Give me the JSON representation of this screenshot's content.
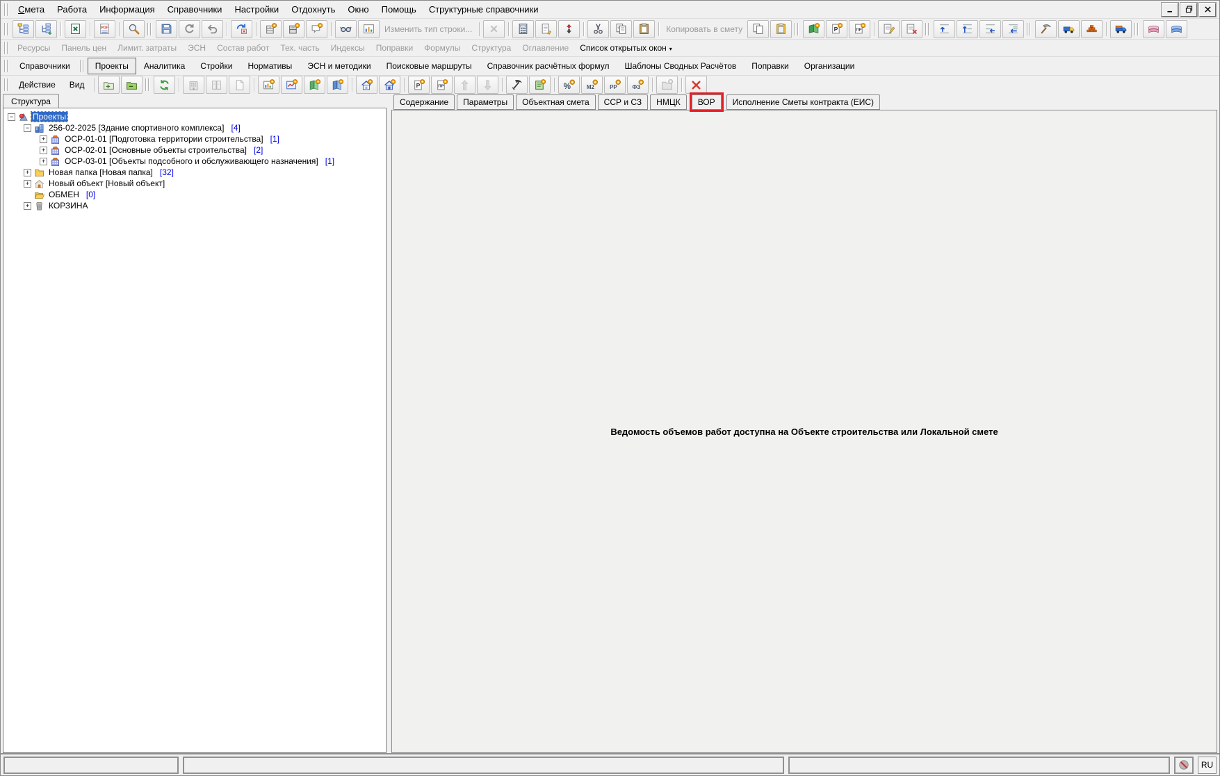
{
  "colors": {
    "selection_blue": "#316ac5",
    "count_blue": "#0000e6",
    "highlight_red": "#e41e26"
  },
  "menubar": {
    "items": [
      {
        "id": "smeta",
        "label": "Смета",
        "accel": true
      },
      {
        "id": "rabota",
        "label": "Работа"
      },
      {
        "id": "informaciya",
        "label": "Информация"
      },
      {
        "id": "spravochniki",
        "label": "Справочники"
      },
      {
        "id": "nastroyki",
        "label": "Настройки"
      },
      {
        "id": "otdohnut",
        "label": "Отдохнуть"
      },
      {
        "id": "okno",
        "label": "Окно"
      },
      {
        "id": "pomosch",
        "label": "Помощь"
      },
      {
        "id": "strukturnye-spravochniki",
        "label": "Структурные справочники"
      }
    ]
  },
  "window_controls": [
    "minimize",
    "restore",
    "close"
  ],
  "toolbar_main": {
    "groups": [
      {
        "grip": true,
        "buttons": [
          {
            "icon": "tree-structure"
          },
          {
            "icon": "tree-add"
          }
        ]
      },
      {
        "buttons": [
          {
            "icon": "excel"
          }
        ]
      },
      {
        "buttons": [
          {
            "icon": "pdf"
          }
        ]
      },
      {
        "buttons": [
          {
            "icon": "search"
          }
        ]
      },
      {
        "grip": true,
        "buttons": [
          {
            "icon": "save"
          },
          {
            "icon": "refresh"
          },
          {
            "icon": "undo"
          }
        ]
      },
      {
        "buttons": [
          {
            "icon": "unlock"
          }
        ]
      },
      {
        "buttons": [
          {
            "icon": "cabinet-gear"
          },
          {
            "icon": "cabinet-gear2"
          },
          {
            "icon": "comment-gear"
          }
        ]
      },
      {
        "buttons": [
          {
            "icon": "glasses"
          },
          {
            "icon": "chart"
          },
          {
            "label": "Изменить тип строки...",
            "disabled": true,
            "name": "change-row-type-button"
          }
        ]
      },
      {
        "buttons": [
          {
            "icon": "close-gray",
            "disabled": true
          }
        ]
      },
      {
        "buttons": [
          {
            "icon": "calculator"
          },
          {
            "icon": "page-edit"
          },
          {
            "icon": "sort-updown"
          }
        ]
      },
      {
        "buttons": [
          {
            "icon": "cut"
          },
          {
            "icon": "copy"
          },
          {
            "icon": "paste"
          }
        ]
      },
      {
        "buttons": [
          {
            "label": "Копировать в смету",
            "disabled": true,
            "name": "copy-to-estimate-button"
          },
          {
            "icon": "copy-doc"
          },
          {
            "icon": "paste-doc"
          }
        ]
      },
      {
        "grip": true,
        "buttons": [
          {
            "icon": "book-gear"
          },
          {
            "icon": "page-p"
          },
          {
            "icon": "page-pr"
          }
        ]
      },
      {
        "buttons": [
          {
            "icon": "edit-add"
          },
          {
            "icon": "edit-del"
          }
        ]
      },
      {
        "grip": true,
        "buttons": [
          {
            "icon": "indent-up"
          },
          {
            "icon": "indent-up2"
          },
          {
            "icon": "indent-left"
          },
          {
            "icon": "indent-left2"
          }
        ]
      },
      {
        "grip": true,
        "buttons": [
          {
            "icon": "hammer"
          },
          {
            "icon": "truck"
          },
          {
            "icon": "bricks"
          }
        ]
      },
      {
        "buttons": [
          {
            "icon": "truck-cargo"
          }
        ]
      },
      {
        "grip": true,
        "buttons": [
          {
            "icon": "book-pink"
          },
          {
            "icon": "book-blue"
          }
        ]
      }
    ]
  },
  "panel_strip": {
    "dropdown_glyph": "▾",
    "items": [
      {
        "id": "resursy",
        "label": "Ресурсы",
        "disabled": true
      },
      {
        "id": "panel-cen",
        "label": "Панель цен",
        "disabled": true
      },
      {
        "id": "limit-zatraty",
        "label": "Лимит. затраты",
        "disabled": true
      },
      {
        "id": "esn",
        "label": "ЭСН",
        "disabled": true
      },
      {
        "id": "sostav-rabot",
        "label": "Состав работ",
        "disabled": true
      },
      {
        "id": "teh-chast",
        "label": "Тех. часть",
        "disabled": true
      },
      {
        "id": "indeksy",
        "label": "Индексы",
        "disabled": true
      },
      {
        "id": "popravki",
        "label": "Поправки",
        "disabled": true
      },
      {
        "id": "formuly",
        "label": "Формулы",
        "disabled": true
      },
      {
        "id": "struktura",
        "label": "Структура",
        "disabled": true
      },
      {
        "id": "oglavlenie",
        "label": "Оглавление",
        "disabled": true
      },
      {
        "id": "spisok-otkrytyh-okon",
        "label": "Список открытых окон",
        "disabled": false,
        "dropdown": true
      }
    ]
  },
  "main_tabs": {
    "items": [
      {
        "id": "spravochniki",
        "label": "Справочники",
        "grip": true
      },
      {
        "id": "proekty",
        "label": "Проекты",
        "grip": true,
        "active": true
      },
      {
        "id": "analitika",
        "label": "Аналитика"
      },
      {
        "id": "stroyki",
        "label": "Стройки"
      },
      {
        "id": "normativy",
        "label": "Нормативы"
      },
      {
        "id": "esn-i-metodiki",
        "label": "ЭСН и методики"
      },
      {
        "id": "poiskovye-marshruty",
        "label": "Поисковые маршруты"
      },
      {
        "id": "spravochnik-raschetnyh-formul",
        "label": "Справочник расчётных формул"
      },
      {
        "id": "shablony-svodnyh-raschetov",
        "label": "Шаблоны Сводных Расчётов"
      },
      {
        "id": "popravki",
        "label": "Поправки"
      },
      {
        "id": "organizacii",
        "label": "Организации"
      }
    ]
  },
  "action_bar": {
    "menus": [
      {
        "id": "deystvie",
        "label": "Действие"
      },
      {
        "id": "vid",
        "label": "Вид"
      }
    ],
    "groups": [
      {
        "buttons": [
          {
            "icon": "folder-plus"
          },
          {
            "icon": "folder-minus"
          }
        ]
      },
      {
        "grip": true,
        "buttons": [
          {
            "icon": "refresh-green"
          }
        ]
      },
      {
        "buttons": [
          {
            "icon": "building",
            "disabled": true
          },
          {
            "icon": "book-columns",
            "disabled": true
          },
          {
            "icon": "page-small",
            "disabled": true
          }
        ]
      },
      {
        "buttons": [
          {
            "icon": "chart-gear"
          },
          {
            "icon": "chart-gear2"
          },
          {
            "icon": "book-green-gear"
          },
          {
            "icon": "book-blue-gear"
          }
        ]
      },
      {
        "buttons": [
          {
            "icon": "house-gear"
          },
          {
            "icon": "house-gear2"
          }
        ]
      },
      {
        "buttons": [
          {
            "icon": "page-p",
            "name": "page-p-action-button"
          },
          {
            "icon": "page-pr",
            "name": "page-pr-action-button"
          },
          {
            "icon": "arrow-up",
            "disabled": true
          },
          {
            "icon": "arrow-down",
            "disabled": true
          }
        ]
      },
      {
        "buttons": [
          {
            "icon": "pickaxe-dark"
          },
          {
            "icon": "green-doc-gear"
          }
        ]
      },
      {
        "buttons": [
          {
            "icon": "percent-gear"
          },
          {
            "icon": "m2-gear"
          },
          {
            "icon": "pp-gear"
          },
          {
            "icon": "f3-gear"
          }
        ]
      },
      {
        "buttons": [
          {
            "icon": "folder-gear",
            "disabled": true
          }
        ]
      },
      {
        "buttons": [
          {
            "icon": "close-red"
          }
        ]
      }
    ]
  },
  "left_panel": {
    "tab_label": "Структура",
    "tree": [
      {
        "id": "proekty",
        "level": 0,
        "expander": "minus",
        "icon": "projects",
        "label": "Проекты",
        "selected": true
      },
      {
        "id": "256-02-2025",
        "level": 1,
        "expander": "minus",
        "icon": "building-blue",
        "label": "256-02-2025 [Здание спортивного комплекса]",
        "count": "[4]"
      },
      {
        "id": "osr-01-01",
        "level": 2,
        "expander": "plus",
        "icon": "osr-object",
        "label": "ОСР-01-01 [Подготовка территории строительства]",
        "count": "[1]"
      },
      {
        "id": "osr-02-01",
        "level": 2,
        "expander": "plus",
        "icon": "osr-object",
        "label": "ОСР-02-01 [Основные объекты строительства]",
        "count": "[2]"
      },
      {
        "id": "osr-03-01",
        "level": 2,
        "expander": "plus",
        "icon": "osr-object",
        "label": "ОСР-03-01 [Объекты подсобного и обслуживающего назначения]",
        "count": "[1]"
      },
      {
        "id": "novaya-papka",
        "level": 1,
        "expander": "plus",
        "icon": "folder-yellow",
        "label": "Новая папка [Новая папка]",
        "count": "[32]"
      },
      {
        "id": "novyy-obekt",
        "level": 1,
        "expander": "plus",
        "icon": "house-object",
        "label": "Новый объект [Новый объект]"
      },
      {
        "id": "obmen",
        "level": 1,
        "expander": "none",
        "icon": "exchange",
        "label": "ОБМЕН",
        "count": "[0]"
      },
      {
        "id": "korzina",
        "level": 1,
        "expander": "plus",
        "icon": "trash",
        "label": "КОРЗИНА"
      }
    ]
  },
  "right_panel": {
    "tabs": [
      {
        "id": "soderzhanie",
        "label": "Содержание"
      },
      {
        "id": "parametry",
        "label": "Параметры"
      },
      {
        "id": "obektnaya-smeta",
        "label": "Объектная смета"
      },
      {
        "id": "ssr-i-sz",
        "label": "ССР и СЗ"
      },
      {
        "id": "nmck",
        "label": "НМЦК"
      },
      {
        "id": "vor",
        "label": "ВОР",
        "active": true,
        "highlighted": true
      },
      {
        "id": "ispolnenie-smety-kontrakta-eis",
        "label": "Исполнение Сметы контракта (ЕИС)"
      }
    ],
    "message": "Ведомость объемов работ доступна на Объекте строительства или Локальной смете"
  },
  "status_bar": {
    "panels": [
      "",
      "",
      ""
    ],
    "language": "RU"
  }
}
